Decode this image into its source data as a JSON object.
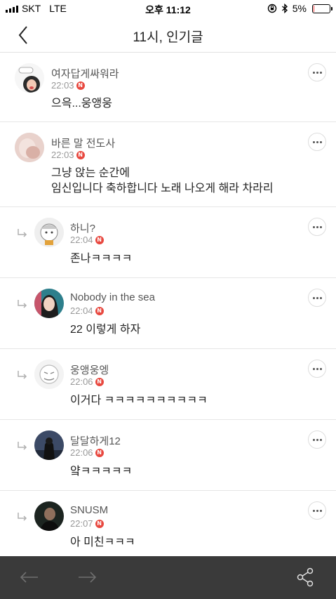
{
  "status_bar": {
    "carrier": "SKT",
    "network": "LTE",
    "time": "오후 11:12",
    "battery": "5%",
    "battery_level": 0.05
  },
  "header": {
    "title": "11시, 인기글"
  },
  "colors": {
    "badge": "#e8483f",
    "bottom_bar": "#3a3a3a",
    "divider": "#e6e6e6"
  },
  "badge_letter": "N",
  "comments": [
    {
      "author": "여자답게싸워라",
      "time": "22:03",
      "lines": [
        "으윽...웅앵웅"
      ],
      "reply": false
    },
    {
      "author": "바른 말 전도사",
      "time": "22:03",
      "lines": [
        "그냥 앉는 순간에",
        "임신입니다 축하합니다 노래 나오게 해라 차라리"
      ],
      "reply": false
    },
    {
      "author": "하니?",
      "time": "22:04",
      "lines": [
        "존나ㅋㅋㅋㅋ"
      ],
      "reply": true
    },
    {
      "author": "Nobody in the sea",
      "time": "22:04",
      "lines": [
        "22 이렇게 하자"
      ],
      "reply": true
    },
    {
      "author": "웅앵웅엥",
      "time": "22:06",
      "lines": [
        "이거다 ㅋㅋㅋㅋㅋㅋㅋㅋㅋㅋ"
      ],
      "reply": true
    },
    {
      "author": "달달하게12",
      "time": "22:06",
      "lines": [
        "얔ㅋㅋㅋㅋㅋ"
      ],
      "reply": true
    },
    {
      "author": "SNUSM",
      "time": "22:07",
      "lines": [
        "아 미친ㅋㅋㅋ"
      ],
      "reply": true
    }
  ]
}
